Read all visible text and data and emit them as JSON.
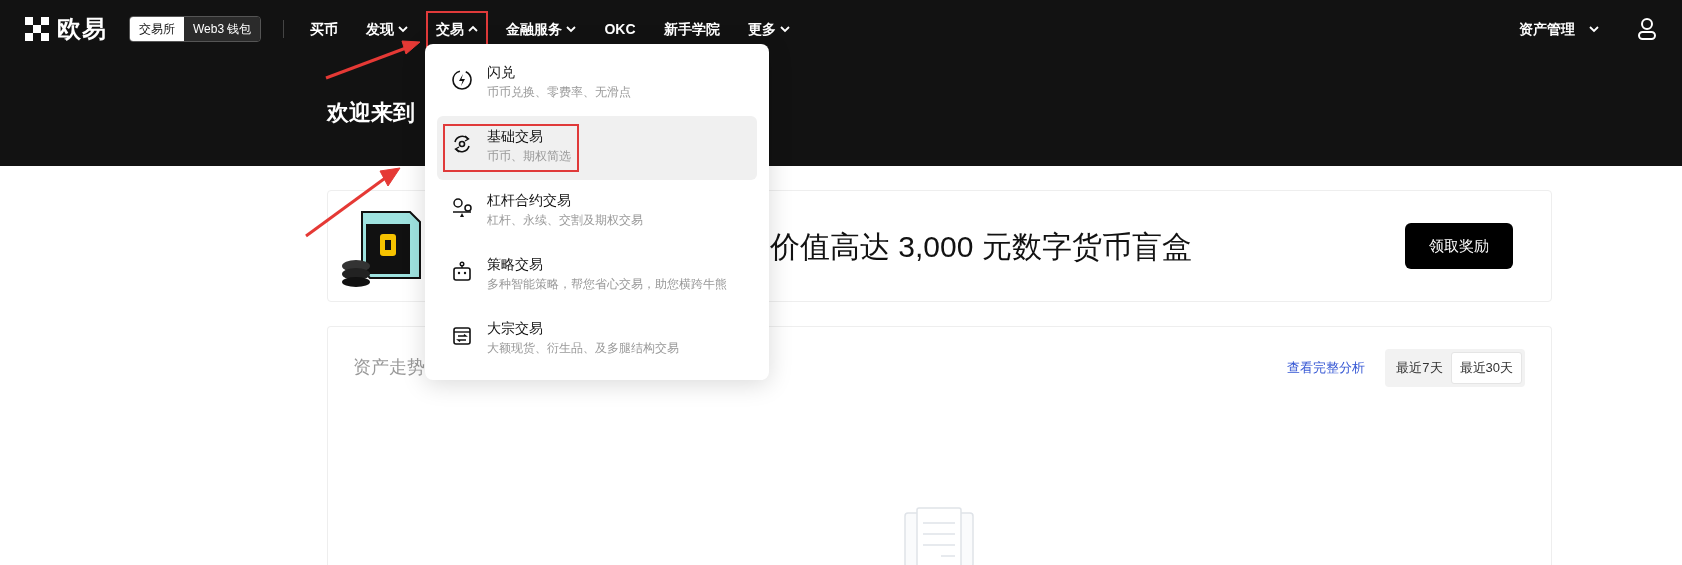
{
  "logo": {
    "text": "欧易"
  },
  "mode_toggle": [
    {
      "label": "交易所",
      "selected": true
    },
    {
      "label": "Web3 钱包",
      "selected": false
    }
  ],
  "nav": [
    {
      "label": "买币",
      "kind": "link",
      "highlighted": false
    },
    {
      "label": "发现",
      "kind": "menu",
      "highlighted": false
    },
    {
      "label": "交易",
      "kind": "openmenu",
      "highlighted": true
    },
    {
      "label": "金融服务",
      "kind": "menu",
      "highlighted": false
    },
    {
      "label": "OKC",
      "kind": "link",
      "highlighted": false
    },
    {
      "label": "新手学院",
      "kind": "link",
      "highlighted": false
    },
    {
      "label": "更多",
      "kind": "menu",
      "highlighted": false
    }
  ],
  "nav_right": {
    "label": "资产管理",
    "kind": "menu"
  },
  "dropdown": {
    "items": [
      {
        "title": "闪兑",
        "subtitle": "币币兑换、零费率、无滑点",
        "selected": false,
        "highlighted": false
      },
      {
        "title": "基础交易",
        "subtitle": "币币、期权简选",
        "selected": true,
        "highlighted": true
      },
      {
        "title": "杠杆合约交易",
        "subtitle": "杠杆、永续、交割及期权交易",
        "selected": false,
        "highlighted": false
      },
      {
        "title": "策略交易",
        "subtitle": "多种智能策略，帮您省心交易，助您横跨牛熊",
        "selected": false,
        "highlighted": false
      },
      {
        "title": "大宗交易",
        "subtitle": "大额现货、衍生品、及多腿结构交易",
        "selected": false,
        "highlighted": false
      }
    ]
  },
  "hero": {
    "title": "欢迎来到"
  },
  "banner": {
    "text": "价值高达 3,000 元数字货币盲盒",
    "button": "领取奖励"
  },
  "asset_chart": {
    "title": "资产走势",
    "link": "查看完整分析",
    "ranges": [
      {
        "label": "最近7天",
        "selected": false
      },
      {
        "label": "最近30天",
        "selected": true
      }
    ]
  }
}
